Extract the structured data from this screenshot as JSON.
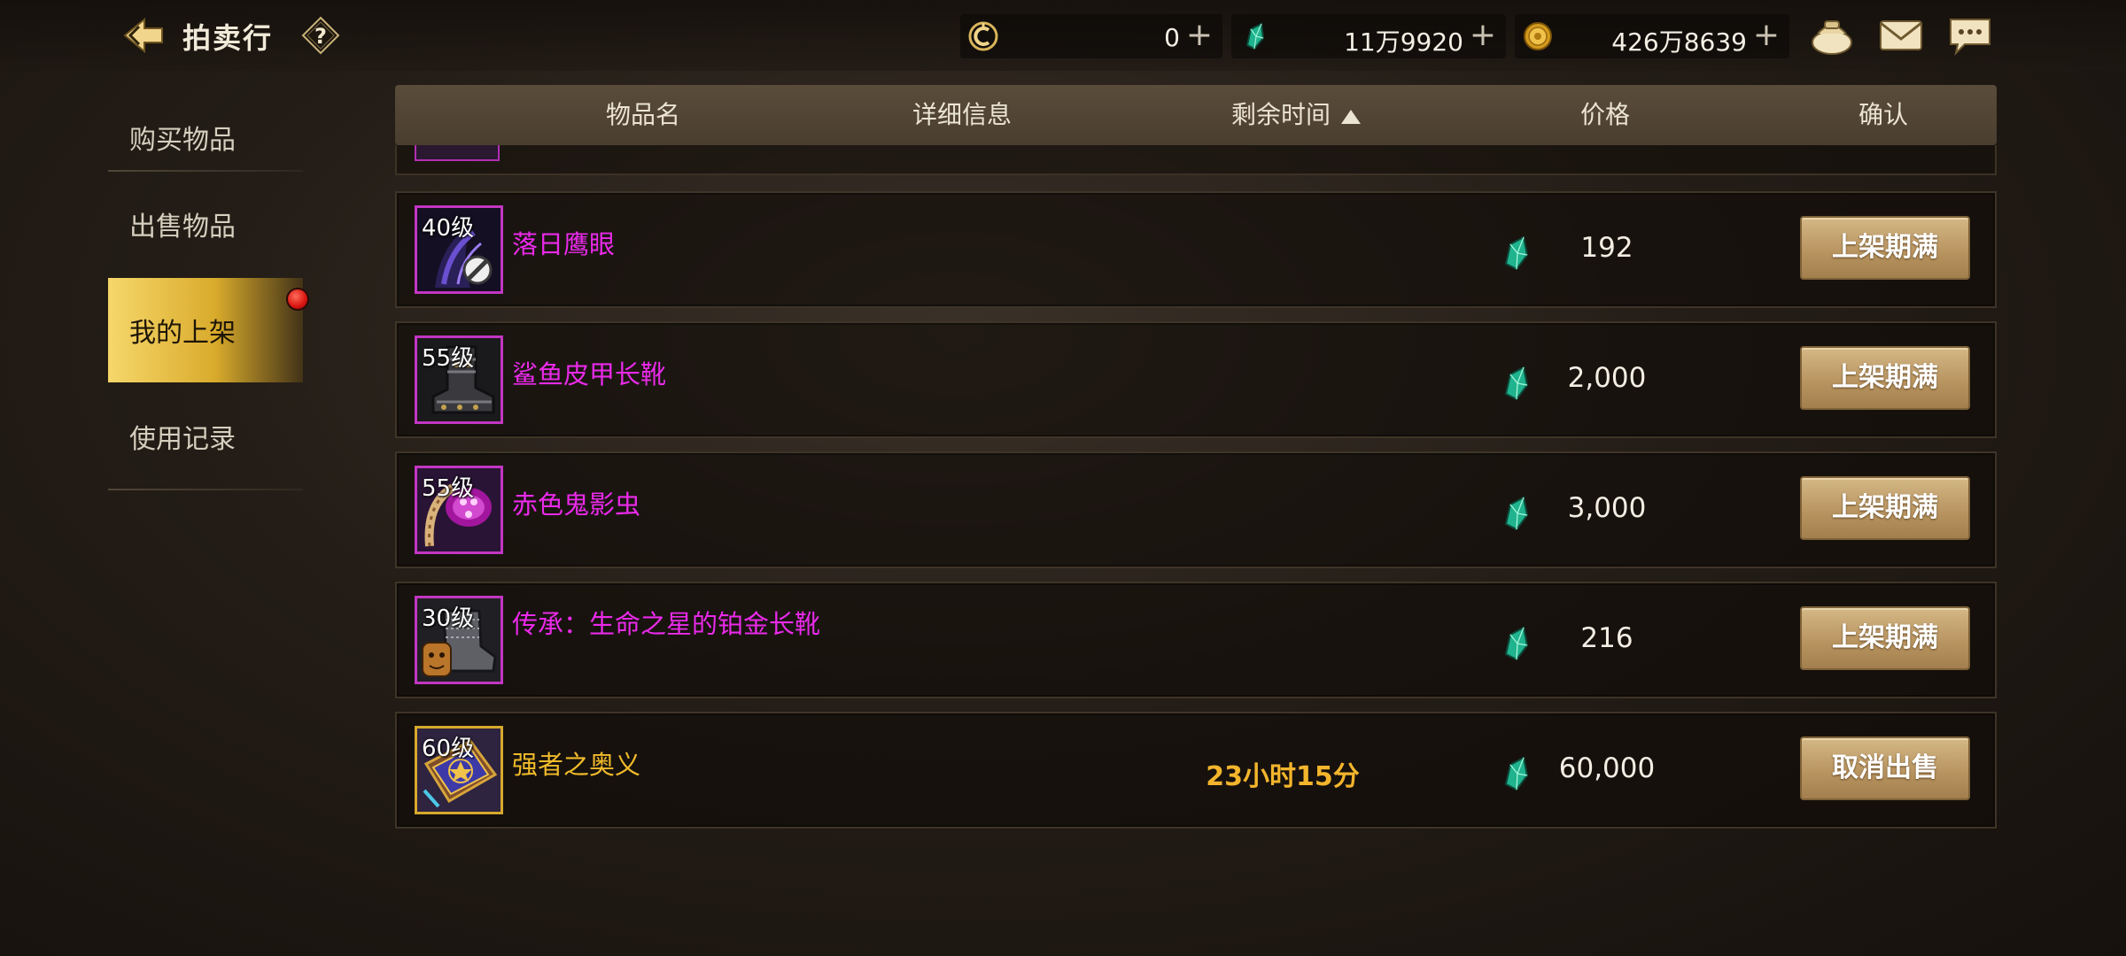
{
  "header": {
    "title": "拍卖行",
    "help_label": "?",
    "currencies": [
      {
        "icon": "credit-coin-icon",
        "value": "0"
      },
      {
        "icon": "green-gem-icon",
        "value": "11万9920"
      },
      {
        "icon": "gold-coin-icon",
        "value": "426万8639"
      }
    ],
    "plus_label": "+"
  },
  "sidebar": {
    "items": [
      {
        "label": "购买物品",
        "active": false
      },
      {
        "label": "出售物品",
        "active": false
      },
      {
        "label": "我的上架",
        "active": true
      },
      {
        "label": "使用记录",
        "active": false
      }
    ]
  },
  "table": {
    "columns": [
      "物品名",
      "详细信息",
      "剩余时间",
      "价格",
      "确认"
    ],
    "sort_column": "剩余时间",
    "sort_direction": "ascending",
    "rows": [
      {
        "level": "40级",
        "name": "落日鹰眼",
        "rarity_color": "#ea2aea",
        "time_left": "",
        "price": "192",
        "action": "上架期满",
        "icon": "hawk-eye-item-icon"
      },
      {
        "level": "55级",
        "name": "鲨鱼皮甲长靴",
        "rarity_color": "#ea2aea",
        "time_left": "",
        "price": "2,000",
        "action": "上架期满",
        "icon": "leather-boots-item-icon"
      },
      {
        "level": "55级",
        "name": "赤色鬼影虫",
        "rarity_color": "#ea2aea",
        "time_left": "",
        "price": "3,000",
        "action": "上架期满",
        "icon": "crimson-beetle-item-icon"
      },
      {
        "level": "30级",
        "name": "传承：生命之星的铂金长靴",
        "rarity_color": "#ea2aea",
        "time_left": "",
        "price": "216",
        "action": "上架期满",
        "icon": "platinum-boots-item-icon"
      },
      {
        "level": "60级",
        "name": "强者之奥义",
        "rarity_color": "#f0bb2a",
        "time_left": "23小时15分",
        "price": "60,000",
        "action": "取消出售",
        "icon": "spell-book-item-icon"
      }
    ]
  },
  "colors": {
    "epic_purple": "#ea2aea",
    "legendary_gold": "#f0bb2a",
    "active_tab_gold": "#d9ab2c",
    "notification_red": "#d8140f"
  }
}
